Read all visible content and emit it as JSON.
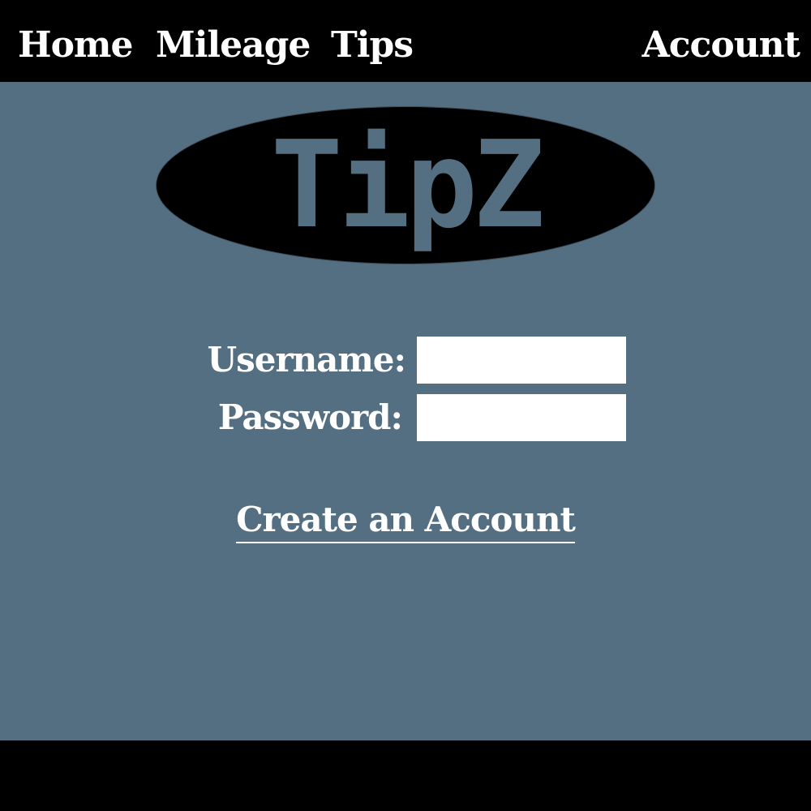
{
  "nav": {
    "home": "Home",
    "mileage": "Mileage",
    "tips": "Tips",
    "account": "Account"
  },
  "logo": {
    "text": "TipZ"
  },
  "login": {
    "username_label": "Username:",
    "username_value": "",
    "password_label": "Password:",
    "password_value": ""
  },
  "create_account_link": "Create an Account",
  "colors": {
    "background": "#556f82",
    "bars": "#000000",
    "text": "#ffffff"
  }
}
